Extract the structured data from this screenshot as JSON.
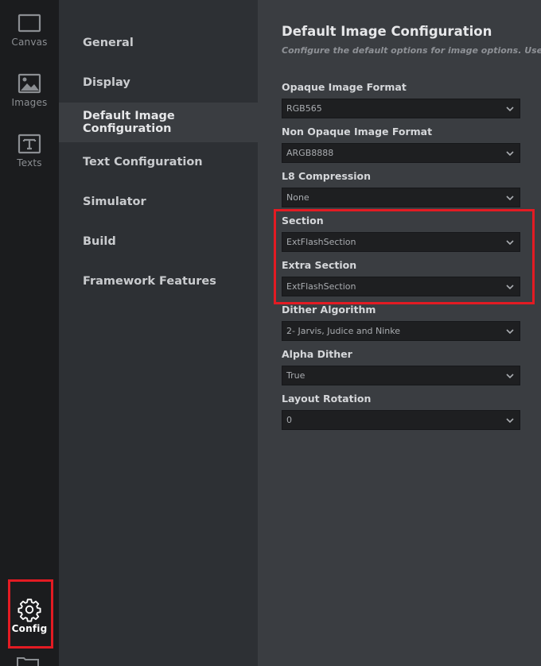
{
  "rail": {
    "items": [
      {
        "label": "Canvas",
        "icon": "canvas-icon"
      },
      {
        "label": "Images",
        "icon": "image-icon"
      },
      {
        "label": "Texts",
        "icon": "text-icon"
      },
      {
        "label": "Config",
        "icon": "gear-icon"
      }
    ]
  },
  "nav": {
    "items": [
      {
        "label": "General"
      },
      {
        "label": "Display"
      },
      {
        "label": "Default Image Configuration"
      },
      {
        "label": "Text Configuration"
      },
      {
        "label": "Simulator"
      },
      {
        "label": "Build"
      },
      {
        "label": "Framework Features"
      }
    ]
  },
  "main": {
    "title": "Default Image Configuration",
    "subtitle": "Configure the default options for image options. Used to op",
    "fields": [
      {
        "label": "Opaque Image Format",
        "value": "RGB565"
      },
      {
        "label": "Non Opaque Image Format",
        "value": "ARGB8888"
      },
      {
        "label": "L8 Compression",
        "value": "None"
      },
      {
        "label": "Section",
        "value": "ExtFlashSection"
      },
      {
        "label": "Extra Section",
        "value": "ExtFlashSection"
      },
      {
        "label": "Dither Algorithm",
        "value": "2- Jarvis, Judice and Ninke"
      },
      {
        "label": "Alpha Dither",
        "value": "True"
      },
      {
        "label": "Layout Rotation",
        "value": "0"
      }
    ]
  },
  "colors": {
    "highlight": "#e31b23",
    "rail_bg": "#1b1c1e",
    "nav_bg": "#2d3034",
    "main_bg": "#3a3d41"
  }
}
